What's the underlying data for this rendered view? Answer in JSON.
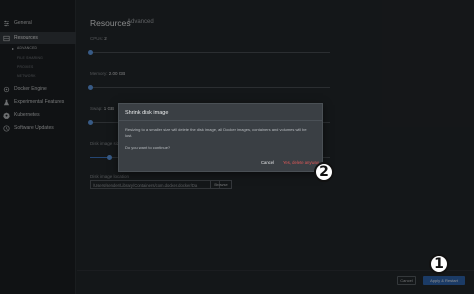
{
  "sidebar": {
    "items": [
      {
        "label": "General",
        "icon": "sliders-icon"
      },
      {
        "label": "Resources",
        "icon": "resources-icon"
      },
      {
        "label": "Docker Engine",
        "icon": "docker-engine-icon"
      },
      {
        "label": "Experimental Features",
        "icon": "flask-icon"
      },
      {
        "label": "Kubernetes",
        "icon": "kubernetes-icon"
      },
      {
        "label": "Software Updates",
        "icon": "clock-icon"
      }
    ],
    "subitems": [
      "ADVANCED",
      "FILE SHARING",
      "PROXIES",
      "NETWORK"
    ],
    "active_item": "Resources",
    "active_subitem": "ADVANCED"
  },
  "header": {
    "title": "Resources",
    "subtitle": "Advanced"
  },
  "settings": {
    "cpus_label": "CPUs:",
    "cpus_value": "2",
    "memory_label": "Memory:",
    "memory_value": "2.00 GB",
    "swap_label": "Swap:",
    "swap_value": "1 GB",
    "disk_label": "Disk image size:",
    "location_label": "Disk image location",
    "location_value": "/Users/sender/Library/Containers/com.docker.docker/Da",
    "browse_label": "Browse"
  },
  "sliders": {
    "cpus": 0.0,
    "memory": 0.0,
    "swap": 0.0,
    "disk": 0.08
  },
  "footer": {
    "cancel_label": "Cancel",
    "apply_label": "Apply & Restart"
  },
  "dialog": {
    "title": "Shrink disk image",
    "body": "Resizing to a smaller size will delete the disk image, all Docker images, containers and volumes will be lost.",
    "question": "Do you want to continue?",
    "cancel_label": "Cancel",
    "delete_label": "Yes, delete anyway"
  },
  "markers": {
    "first": "1",
    "second": "2"
  },
  "colors": {
    "accent": "#2f66b0",
    "danger": "#e05858",
    "background": "#24282b",
    "sidebar": "#1d2023"
  }
}
